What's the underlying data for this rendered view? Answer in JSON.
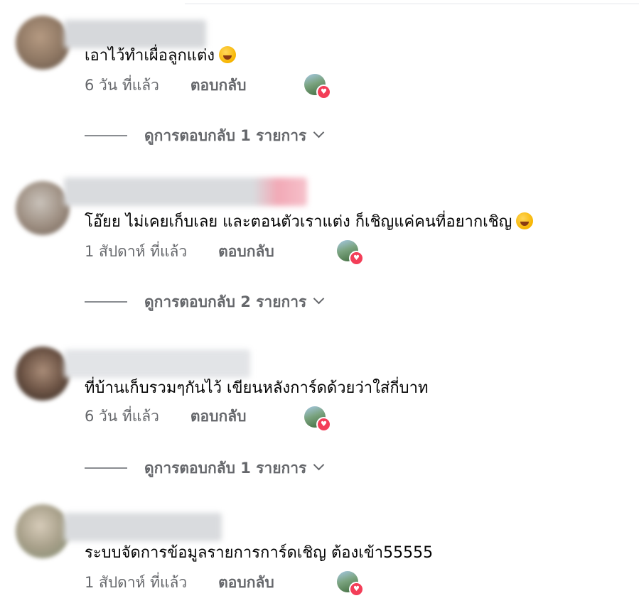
{
  "comments": [
    {
      "text": "เอาไว้ทำเผื่อลูกแต่ง",
      "emoji": "rolling-laughing-emoji",
      "time": "6 วัน ที่แล้ว",
      "reply_label": "ตอบกลับ",
      "replies_label": "ดูการตอบกลับ 1 รายการ"
    },
    {
      "text": "โอ๊ยย ไม่เคยเก็บเลย และตอนตัวเราแต่ง ก็เชิญแค่คนที่อยากเชิญ",
      "emoji": "grinning-sweat-emoji",
      "time": "1 สัปดาห์ ที่แล้ว",
      "reply_label": "ตอบกลับ",
      "replies_label": "ดูการตอบกลับ 2 รายการ"
    },
    {
      "text": "ที่บ้านเก็บรวมๆกันไว้ เขียนหลังการ์ดด้วยว่าใส่กี่บาท",
      "emoji": "",
      "time": "6 วัน ที่แล้ว",
      "reply_label": "ตอบกลับ",
      "replies_label": "ดูการตอบกลับ 1 รายการ"
    },
    {
      "text": "ระบบจัดการข้อมูลรายการการ์ดเชิญ ต้องเข้า55555",
      "emoji": "",
      "time": "1 สัปดาห์ ที่แล้ว",
      "reply_label": "ตอบกลับ",
      "replies_label": ""
    }
  ],
  "reaction": {
    "icon": "heart-icon",
    "color": "#f33e58",
    "glyph": "♥"
  },
  "colors": {
    "text": "#050505",
    "secondary": "#65676b"
  }
}
